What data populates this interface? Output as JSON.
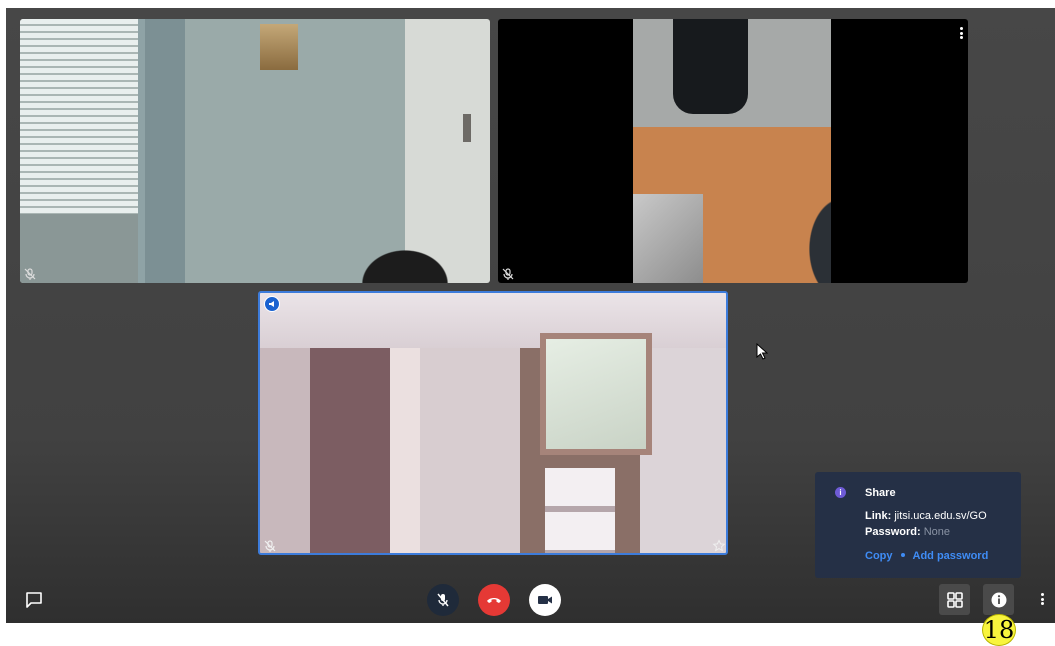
{
  "share_popup": {
    "title": "Share",
    "link_label": "Link:",
    "link_value": "jitsi.uca.edu.sv/GO",
    "password_label": "Password:",
    "password_value": "None",
    "copy_label": "Copy",
    "add_password_label": "Add password"
  },
  "badge": {
    "number": "18"
  },
  "colors": {
    "hangup": "#e53935",
    "popup_bg": "#253046",
    "link_accent": "#3f8cf5",
    "speaker_border": "#3d7cdb",
    "badge_yellow": "#f8f43d"
  },
  "icons": {
    "chat": "chat-bubble-icon",
    "mic": "mic-muted-icon",
    "hangup": "phone-hangup-icon",
    "camera": "video-camera-icon",
    "tile_view": "tile-view-icon",
    "info": "info-icon",
    "more": "more-vertical-icon"
  }
}
